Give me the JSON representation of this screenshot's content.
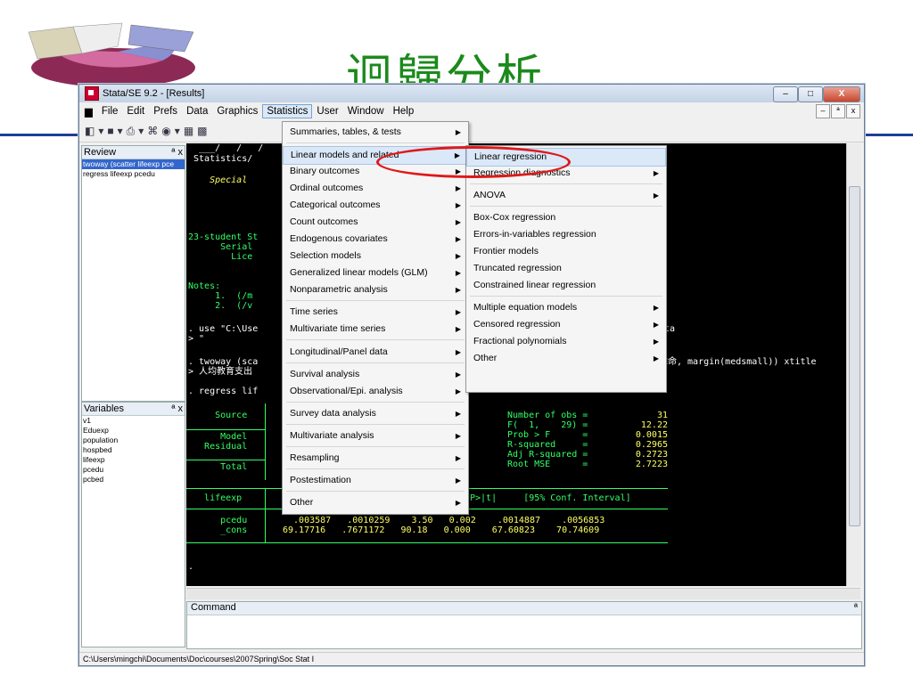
{
  "slide": {
    "title": "迴歸分析"
  },
  "window": {
    "title": "Stata/SE 9.2 - [Results]",
    "minimize": "–",
    "maximize": "□",
    "close": "X",
    "mdi_min": "–",
    "mdi_restore": "ª",
    "mdi_close": "x"
  },
  "menubar": [
    "File",
    "Edit",
    "Prefs",
    "Data",
    "Graphics",
    "Statistics",
    "User",
    "Window",
    "Help"
  ],
  "toolbar": [
    "◧",
    "▾",
    "■",
    "▾",
    "⎙",
    "▾",
    "⌘",
    "◉",
    "▾",
    "▦",
    "▩"
  ],
  "review": {
    "title": "Review",
    "pin": "ª",
    "close": "x",
    "items": [
      "twoway (scatter lifeexp pce",
      "regress lifeexp pcedu"
    ]
  },
  "variables": {
    "title": "Variables",
    "pin": "ª",
    "close": "x",
    "items": [
      "v1",
      "Eduexp",
      "population",
      "hospbed",
      "lifeexp",
      "pcedu",
      "pcbed"
    ]
  },
  "results": {
    "lines": [
      {
        "text": "  ___/   /   /",
        "color": "wht"
      },
      {
        "text": " Statistics/",
        "color": "wht"
      },
      {
        "text": "    Special",
        "color": "yel"
      },
      {
        "text": "23-student St",
        "color": "grn"
      },
      {
        "text": "      Serial",
        "color": "grn"
      },
      {
        "text": "        Lice",
        "color": "grn"
      },
      {
        "text": "Notes:",
        "color": "grn"
      },
      {
        "text": "     1.  (/m",
        "color": "grn"
      },
      {
        "text": "     2.  (/v",
        "color": "grn"
      },
      {
        "text": ". use \"C:\\Use",
        "color": "wht"
      },
      {
        "text": "> \"",
        "color": "wht"
      },
      {
        "text": ". twoway (sca",
        "color": "wht"
      },
      {
        "text": "> 人均教育支出",
        "color": "wht"
      },
      {
        "text": ". regress lif",
        "color": "wht"
      },
      {
        "text": "     Source",
        "color": "grn"
      },
      {
        "text": "      Model",
        "color": "grn"
      },
      {
        "text": "   Residual",
        "color": "grn"
      },
      {
        "text": "      Total",
        "color": "grn"
      },
      {
        "text": "   lifeexp",
        "color": "grn"
      },
      {
        "text": "      pcedu",
        "color": "grn"
      },
      {
        "text": "      _cons",
        "color": "grn"
      },
      {
        "text": ".",
        "color": "wht"
      }
    ],
    "right_text": [
      {
        "text": "dta",
        "color": "wht"
      },
      {
        "text": "餘命, margin(medsmall)) xtitle",
        "color": "wht"
      }
    ],
    "stats": [
      {
        "label": "Number of obs =",
        "value": "31"
      },
      {
        "label": "F(  1,    29) =",
        "value": "12.22"
      },
      {
        "label": "Prob > F      =",
        "value": "0.0015"
      },
      {
        "label": "R-squared     =",
        "value": "0.2965"
      },
      {
        "label": "Adj R-squared =",
        "value": "0.2723"
      },
      {
        "label": "Root MSE      =",
        "value": "2.7223"
      }
    ],
    "coef_header": "P>|t|     [95% Conf. Interval]",
    "coef_rows": [
      "  .003587   .0010259    3.50   0.002    .0014887    .0056853",
      "69.17716   .7671172   90.18   0.000    67.60823    70.74609"
    ]
  },
  "command": {
    "title": "Command",
    "pin": "ª"
  },
  "statusbar": {
    "path": "C:\\Users\\mingchi\\Documents\\Doc\\courses\\2007Spring\\Soc Stat I"
  },
  "stats_menu": [
    {
      "label": "Summaries, tables, & tests",
      "sub": true
    },
    {
      "label": "Linear models and related",
      "sub": true,
      "hl": true
    },
    {
      "label": "Binary outcomes",
      "sub": true
    },
    {
      "label": "Ordinal outcomes",
      "sub": true
    },
    {
      "label": "Categorical outcomes",
      "sub": true
    },
    {
      "label": "Count outcomes",
      "sub": true
    },
    {
      "label": "Endogenous covariates",
      "sub": true
    },
    {
      "label": "Selection models",
      "sub": true
    },
    {
      "label": "Generalized linear models (GLM)",
      "sub": true
    },
    {
      "label": "Nonparametric analysis",
      "sub": true
    },
    {
      "label": "Time series",
      "sub": true
    },
    {
      "label": "Multivariate time series",
      "sub": true
    },
    {
      "label": "Longitudinal/Panel data",
      "sub": true
    },
    {
      "label": "Survival analysis",
      "sub": true
    },
    {
      "label": "Observational/Epi. analysis",
      "sub": true
    },
    {
      "label": "Survey data analysis",
      "sub": true
    },
    {
      "label": "Multivariate analysis",
      "sub": true
    },
    {
      "label": "Resampling",
      "sub": true
    },
    {
      "label": "Postestimation",
      "sub": true
    },
    {
      "label": "Other",
      "sub": true
    }
  ],
  "linear_menu": [
    {
      "label": "Linear regression",
      "sub": false,
      "hl": true
    },
    {
      "label": "Regression diagnostics",
      "sub": true
    },
    {
      "label": "ANOVA",
      "sub": true
    },
    {
      "label": "Box-Cox regression",
      "sub": false
    },
    {
      "label": "Errors-in-variables regression",
      "sub": false
    },
    {
      "label": "Frontier models",
      "sub": false
    },
    {
      "label": "Truncated regression",
      "sub": false
    },
    {
      "label": "Constrained linear regression",
      "sub": false
    },
    {
      "label": "Multiple equation models",
      "sub": true
    },
    {
      "label": "Censored regression",
      "sub": true
    },
    {
      "label": "Fractional polynomials",
      "sub": true
    },
    {
      "label": "Other",
      "sub": true
    }
  ],
  "colors": {
    "highlight_oval": "#e01818",
    "slide_title": "#1a8a1a",
    "slide_rule": "#1c3f9a"
  }
}
